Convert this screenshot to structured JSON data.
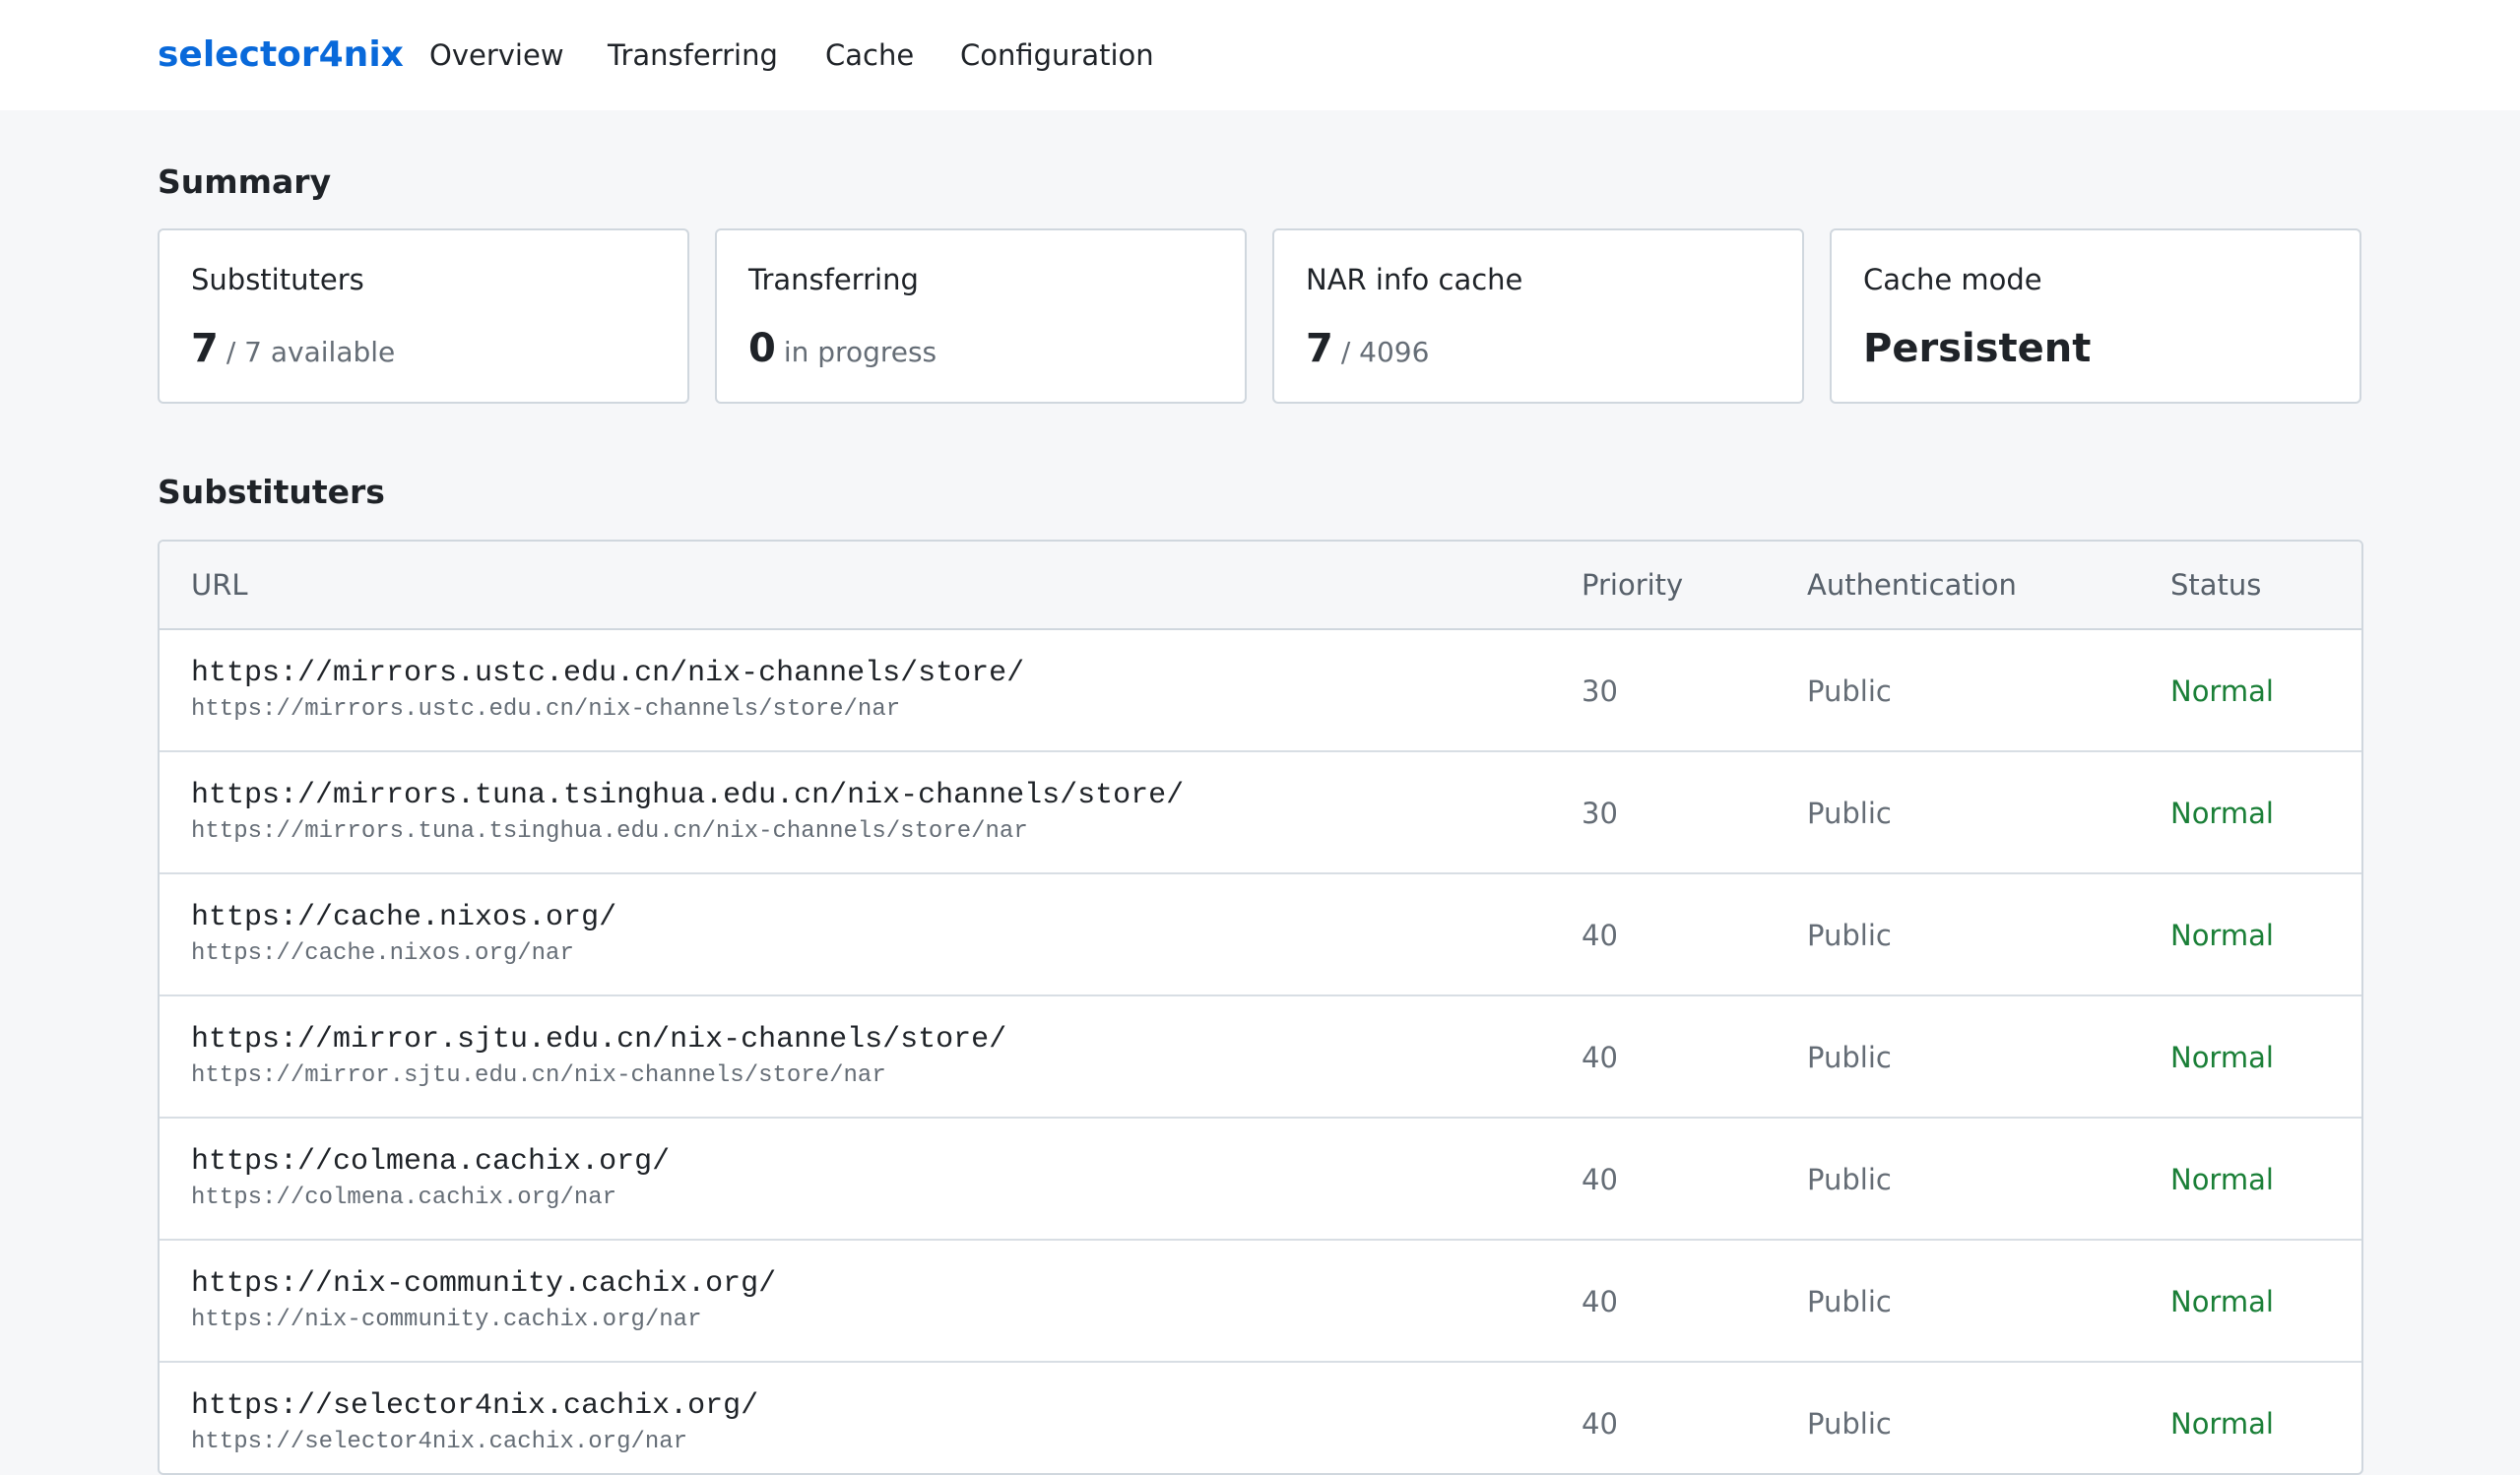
{
  "app": {
    "brand": "selector4nix",
    "nav": [
      "Overview",
      "Transferring",
      "Cache",
      "Configuration"
    ],
    "colors": {
      "brand": "#0969da",
      "status_normal": "#1a7f37",
      "background": "#f6f7f9"
    }
  },
  "summary": {
    "title": "Summary",
    "cards": [
      {
        "label": "Substituters",
        "value": "7",
        "detail": "/ 7 available"
      },
      {
        "label": "Transferring",
        "value": "0",
        "detail": "in progress"
      },
      {
        "label": "NAR info cache",
        "value": "7",
        "detail": "/ 4096"
      },
      {
        "label": "Cache mode",
        "value": "Persistent",
        "detail": ""
      }
    ]
  },
  "substituters": {
    "title": "Substituters",
    "columns": [
      "URL",
      "Priority",
      "Authentication",
      "Status"
    ],
    "rows": [
      {
        "url": "https://mirrors.ustc.edu.cn/nix-channels/store/",
        "nar_url": "https://mirrors.ustc.edu.cn/nix-channels/store/nar",
        "priority": "30",
        "auth": "Public",
        "status": "Normal"
      },
      {
        "url": "https://mirrors.tuna.tsinghua.edu.cn/nix-channels/store/",
        "nar_url": "https://mirrors.tuna.tsinghua.edu.cn/nix-channels/store/nar",
        "priority": "30",
        "auth": "Public",
        "status": "Normal"
      },
      {
        "url": "https://cache.nixos.org/",
        "nar_url": "https://cache.nixos.org/nar",
        "priority": "40",
        "auth": "Public",
        "status": "Normal"
      },
      {
        "url": "https://mirror.sjtu.edu.cn/nix-channels/store/",
        "nar_url": "https://mirror.sjtu.edu.cn/nix-channels/store/nar",
        "priority": "40",
        "auth": "Public",
        "status": "Normal"
      },
      {
        "url": "https://colmena.cachix.org/",
        "nar_url": "https://colmena.cachix.org/nar",
        "priority": "40",
        "auth": "Public",
        "status": "Normal"
      },
      {
        "url": "https://nix-community.cachix.org/",
        "nar_url": "https://nix-community.cachix.org/nar",
        "priority": "40",
        "auth": "Public",
        "status": "Normal"
      },
      {
        "url": "https://selector4nix.cachix.org/",
        "nar_url": "https://selector4nix.cachix.org/nar",
        "priority": "40",
        "auth": "Public",
        "status": "Normal"
      }
    ]
  }
}
